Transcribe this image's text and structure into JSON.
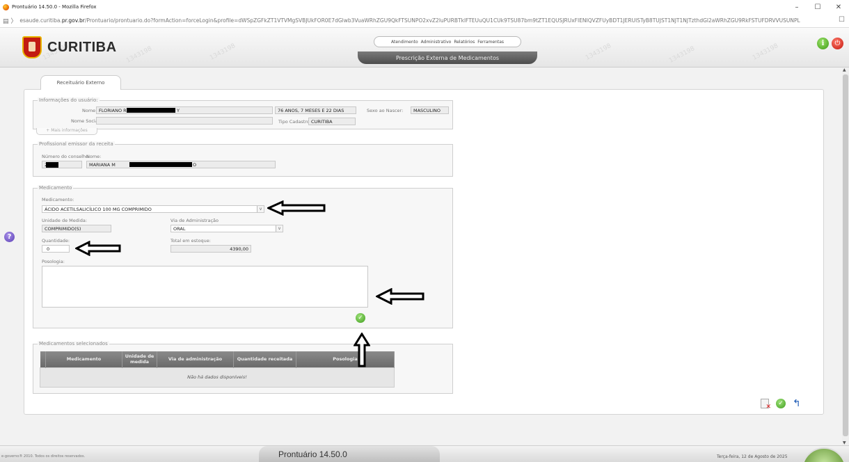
{
  "browser": {
    "window_title": "Prontuário 14.50.0 - Mozilla Firefox",
    "url_pre": "esaude.curitiba.",
    "url_host": "pr.gov.br",
    "url_post": "/Prontuario/prontuario.do?formAction=forceLogin&profile=dWSpZGFkZT1VTVMgSVBJUkFOR0E7dGlwb3VuaWRhZGU9QkFTSUNPO2xvZ2luPURBTklFTEUuQU1CUk9TSU87bm9tZT1EQUSJRUxFIENIQVZFUyBDT1JERUlSTyB8TUJST1NJT1NJTzthdGl2aWRhZGU9RkFSTUFDRVVUSUNPL"
  },
  "header": {
    "logo_text": "CURITIBA",
    "top_menu": [
      "Atendimento",
      "Administrativo",
      "Relatórios",
      "Ferramentas"
    ],
    "page_banner": "Prescrição Externa de Medicamentos",
    "watermark": "1343198"
  },
  "tab": {
    "label": "Receituário Externo"
  },
  "usuario": {
    "legend": "Informações do usuário:",
    "nome_label": "Nome:",
    "nome_value": "FLORIANO R",
    "nome_suffix": "Y",
    "idade": "76 ANOS, 7 MESES E 22 DIAS",
    "sexo_label": "Sexo ao Nascer:",
    "sexo_value": "MASCULINO",
    "nome_social_label": "Nome Social:",
    "nome_social_value": "",
    "tipo_label": "Tipo Cadastro:",
    "tipo_value": "CURITIBA",
    "expander": "+ Mais informações"
  },
  "profissional": {
    "legend": "Profissional emissor da receita",
    "conselho_label": "Número do conselho:",
    "conselho_value": "2",
    "nome_label": "Nome:",
    "nome_value": "MARIANA M",
    "nome_suffix": "O"
  },
  "medicamento": {
    "legend": "Medicamento",
    "med_label": "Medicamento:",
    "med_value": "ÁCIDO ACETILSALICÍLICO 100 MG COMPRIMIDO",
    "unidade_label": "Unidade de Medida:",
    "unidade_value": "COMPRIMIDO(S)",
    "via_label": "Via de Administração",
    "via_value": "ORAL",
    "qtd_label": "Quantidade:",
    "qtd_value": "0",
    "estoque_label": "Total em estoque:",
    "estoque_value": "4390,00",
    "posologia_label": "Posologia:",
    "posologia_value": ""
  },
  "selecionados": {
    "legend": "Medicamentos selecionados",
    "columns": [
      "Medicamento",
      "Unidade de medida",
      "Via de administração",
      "Quantidade receitada",
      "Posologia"
    ],
    "empty": "Não há dados disponíveis!"
  },
  "footer": {
    "copyright": "e-governo® 2010. Todos os direitos reservados.",
    "version": "Prontuário 14.50.0",
    "date": "Terça-feira, 12 de Agosto de 2025"
  },
  "colors": {
    "accent_green": "#4aa320",
    "header_red": "#c21b12",
    "banner_gray": "#5a5a5a"
  }
}
